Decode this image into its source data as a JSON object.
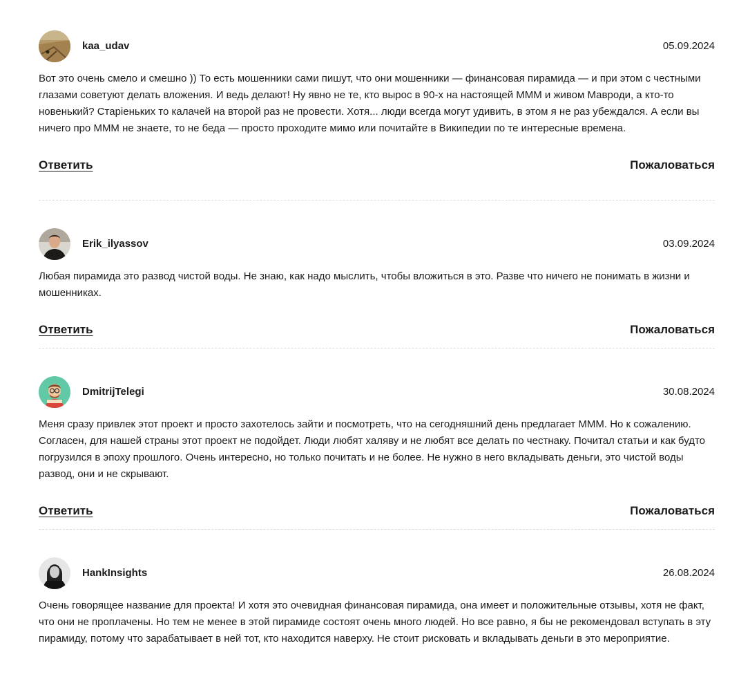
{
  "actions": {
    "reply_label": "Ответить",
    "complain_label": "Пожаловаться"
  },
  "comments": [
    {
      "username": "kaa_udav",
      "date": "05.09.2024",
      "text": "Вот это очень смело и смешно )) То есть мошенники сами пишут, что они мошенники — финансовая пирамида — и при этом с честными глазами советуют делать вложения. И ведь делают! Ну явно не те, кто вырос в 90-х на настоящей МММ и живом Мавроди, а кто-то новенький? Старіеньких то калачей на второй раз не провести. Хотя... люди всегда могут удивить, в этом я не раз убеждался. А если вы ничего про МММ не знаете, то не беда — просто проходите мимо или почитайте в Википедии по те интересные времена."
    },
    {
      "username": "Erik_ilyassov",
      "date": "03.09.2024",
      "text": "Любая пирамида это развод чистой воды. Не знаю, как надо мыслить, чтобы вложиться в это. Разве что ничего не понимать в жизни и мошенниках."
    },
    {
      "username": "DmitrijTelegi",
      "date": "30.08.2024",
      "text": "Меня сразу привлек этот проект и просто захотелось зайти и посмотреть, что на сегодняшний день предлагает МММ. Но к сожалению. Согласен, для нашей страны этот проект не подойдет. Люди любят халяву и не любят все делать по честнаку. Почитал статьи и как будто погрузился в эпоху прошлого. Очень интересно, но только почитать и не более. Не нужно в него вкладывать деньги, это чистой воды развод, они и не скрывают."
    },
    {
      "username": "HankInsights",
      "date": "26.08.2024",
      "text": "Очень говорящее название для проекта! И хотя это очевидная финансовая пирамида, она имеет и положительные отзывы, хотя не факт, что они не проплачены. Но тем не менее в этой пирамиде состоят очень много людей. Но все равно, я бы не рекомендовал вступать в эту пирамиду, потому что зарабатывает в ней тот, кто находится наверху. Не стоит рисковать и вкладывать деньги в это мероприятие."
    }
  ]
}
